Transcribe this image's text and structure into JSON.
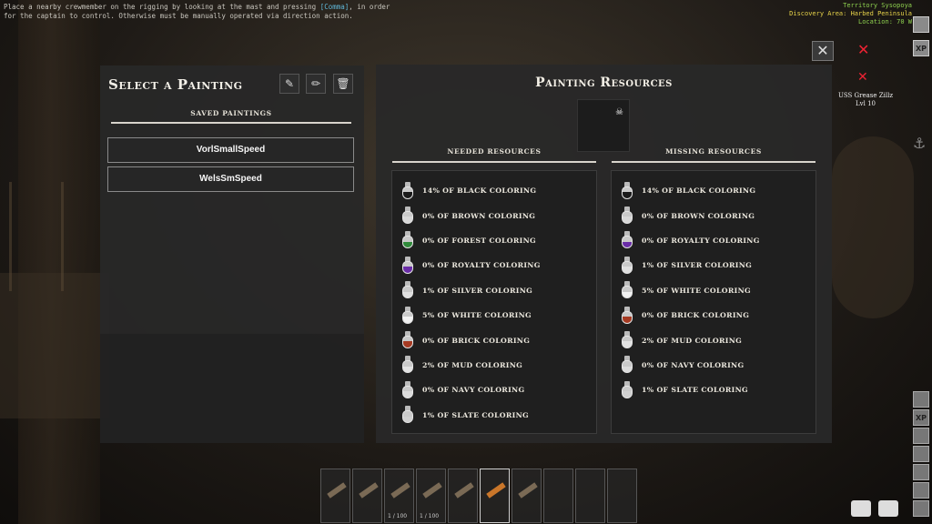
{
  "hint": {
    "text_before": "Place a nearby crewmember on the rigging by looking at the mast and pressing ",
    "key": "[Comma]",
    "text_after": ", in order for the captain to control. Otherwise must be manually operated via direction action."
  },
  "hud": {
    "territory": "Territory Sysopoya",
    "discovery": "Discovery Area: Harbed Peninsula",
    "location": "Location: 70 W",
    "xp": "XP",
    "target_name": "USS Grease Zillz",
    "target_level": "Lvl 10"
  },
  "left_panel": {
    "title": "Select a Painting",
    "saved_header": "SAVED PAINTINGS",
    "paintings": [
      "VorlSmallSpeed",
      "WelsSmSpeed"
    ]
  },
  "right_panel": {
    "title": "Painting Resources",
    "needed_header": "NEEDED RESOURCES",
    "missing_header": "MISSING RESOURCES",
    "needed": [
      {
        "label": "14% OF BLACK COLORING",
        "color": "#1a1a1a"
      },
      {
        "label": "0% OF BROWN COLORING",
        "color": "#d8d8d8"
      },
      {
        "label": "0% OF FOREST COLORING",
        "color": "#2f8a3a"
      },
      {
        "label": "0% OF ROYALTY COLORING",
        "color": "#6a2ca8"
      },
      {
        "label": "1% OF SILVER COLORING",
        "color": "#e0e0e0"
      },
      {
        "label": "5% OF WHITE COLORING",
        "color": "#f2f2f2"
      },
      {
        "label": "0% OF BRICK COLORING",
        "color": "#a63a22"
      },
      {
        "label": "2% OF MUD COLORING",
        "color": "#e3e3e3"
      },
      {
        "label": "0% OF NAVY COLORING",
        "color": "#dcdcdc"
      },
      {
        "label": "1% OF SLATE COLORING",
        "color": "#d0d0d0"
      }
    ],
    "missing": [
      {
        "label": "14% OF BLACK COLORING",
        "color": "#1a1a1a"
      },
      {
        "label": "0% OF BROWN COLORING",
        "color": "#d8d8d8"
      },
      {
        "label": "0% OF ROYALTY COLORING",
        "color": "#6a2ca8"
      },
      {
        "label": "1% OF SILVER COLORING",
        "color": "#e0e0e0"
      },
      {
        "label": "5% OF WHITE COLORING",
        "color": "#f2f2f2"
      },
      {
        "label": "0% OF BRICK COLORING",
        "color": "#a63a22"
      },
      {
        "label": "2% OF MUD COLORING",
        "color": "#e3e3e3"
      },
      {
        "label": "0% OF NAVY COLORING",
        "color": "#dcdcdc"
      },
      {
        "label": "1% OF SLATE COLORING",
        "color": "#d0d0d0"
      }
    ]
  },
  "hotbar": {
    "qty_a": "1 / 100",
    "qty_b": "1 / 100"
  }
}
